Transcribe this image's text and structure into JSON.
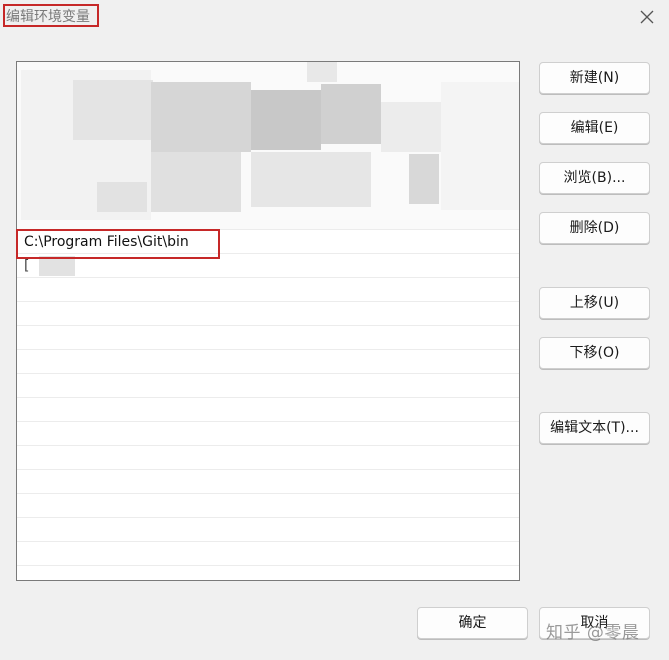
{
  "window": {
    "title": "编辑环境变量",
    "close_icon": "close-icon"
  },
  "list": {
    "blurred_rows": 7,
    "highlighted_entry": "C:\\Program Files\\Git\\bin",
    "partial_entry": "[",
    "empty_rows": 13
  },
  "buttons": {
    "new": "新建(N)",
    "edit": "编辑(E)",
    "browse": "浏览(B)...",
    "delete": "删除(D)",
    "move_up": "上移(U)",
    "move_down": "下移(O)",
    "edit_text": "编辑文本(T)...",
    "ok": "确定",
    "cancel": "取消"
  },
  "watermark": "知乎 @零晨",
  "colors": {
    "highlight_border": "#c62828",
    "dialog_bg": "#f0f0f0",
    "list_bg": "#ffffff"
  }
}
